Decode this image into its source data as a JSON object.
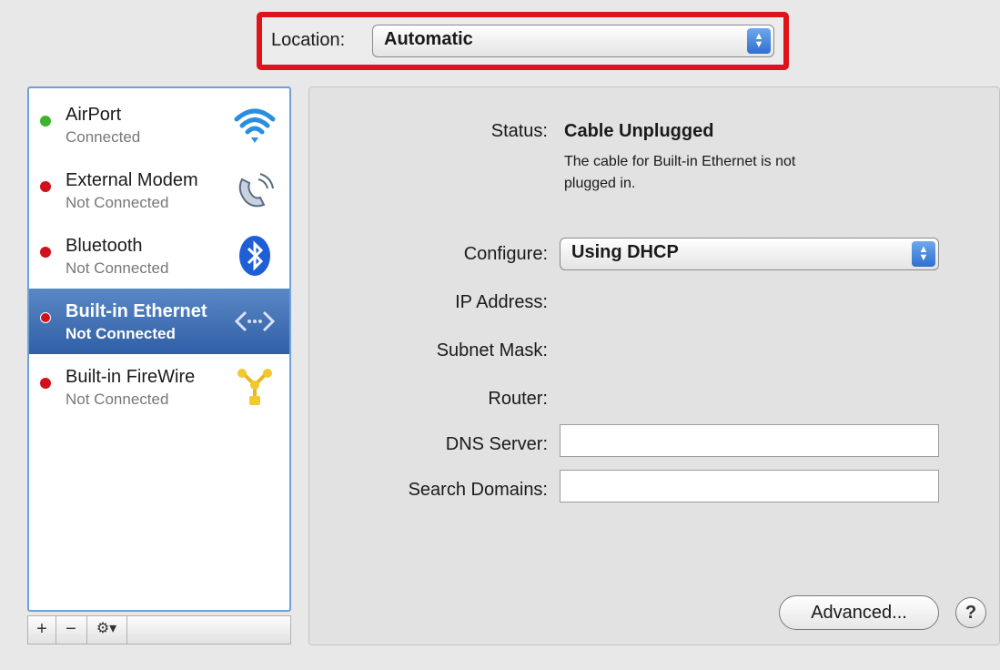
{
  "location": {
    "label": "Location:",
    "value": "Automatic"
  },
  "services": [
    {
      "name": "AirPort",
      "status": "Connected",
      "indicator": "#3db32f",
      "icon": "wifi-icon"
    },
    {
      "name": "External Modem",
      "status": "Not Connected",
      "indicator": "#d0101a",
      "icon": "phone-icon"
    },
    {
      "name": "Bluetooth",
      "status": "Not Connected",
      "indicator": "#d0101a",
      "icon": "bluetooth-icon"
    },
    {
      "name": "Built-in Ethernet",
      "status": "Not Connected",
      "indicator": "#d0101a",
      "icon": "ethernet-icon",
      "selected": true
    },
    {
      "name": "Built-in FireWire",
      "status": "Not Connected",
      "indicator": "#d0101a",
      "icon": "firewire-icon"
    }
  ],
  "toolbar": {
    "add": "+",
    "remove": "−",
    "action": "⚙▾"
  },
  "details": {
    "status_label": "Status:",
    "status_value": "Cable Unplugged",
    "status_desc_1": "The cable for Built-in Ethernet is not",
    "status_desc_2": "plugged in.",
    "configure_label": "Configure:",
    "configure_value": "Using DHCP",
    "ip_label": "IP Address:",
    "subnet_label": "Subnet Mask:",
    "router_label": "Router:",
    "dns_label": "DNS Server:",
    "search_label": "Search Domains:",
    "advanced_button": "Advanced...",
    "help_button": "?"
  }
}
